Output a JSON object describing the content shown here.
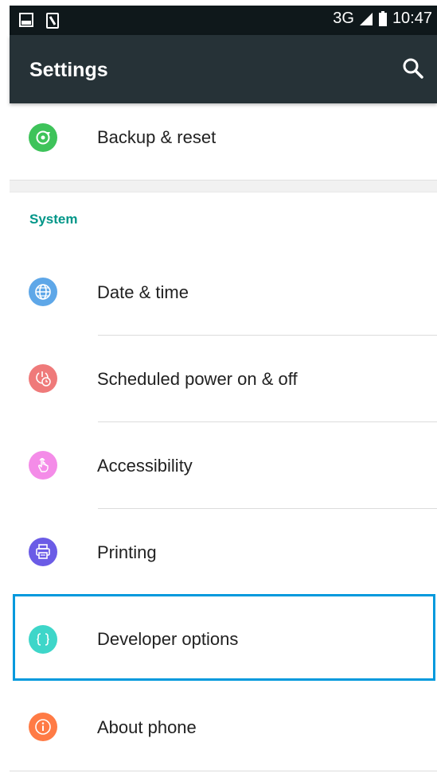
{
  "status_bar": {
    "network": "3G",
    "time": "10:47"
  },
  "app_bar": {
    "title": "Settings",
    "search_icon": "search-icon"
  },
  "items": [
    {
      "label": "Backup & reset",
      "icon": "backup-reset-icon",
      "color": "#3ec35a"
    },
    {
      "label": "Date & time",
      "icon": "globe-icon",
      "color": "#5ea7e8"
    },
    {
      "label": "Scheduled power on & off",
      "icon": "power-schedule-icon",
      "color": "#ef7a7a"
    },
    {
      "label": "Accessibility",
      "icon": "hand-icon",
      "color": "#f48ce8"
    },
    {
      "label": "Printing",
      "icon": "printer-icon",
      "color": "#6b5ce6"
    },
    {
      "label": "Developer options",
      "icon": "braces-icon",
      "color": "#3ed6c9"
    },
    {
      "label": "About phone",
      "icon": "info-icon",
      "color": "#ff7b45"
    }
  ],
  "section": {
    "system_header": "System"
  },
  "colors": {
    "app_bar": "#263237",
    "status_bar": "#0f181b",
    "accent": "#009688",
    "focus": "#0099dd"
  }
}
